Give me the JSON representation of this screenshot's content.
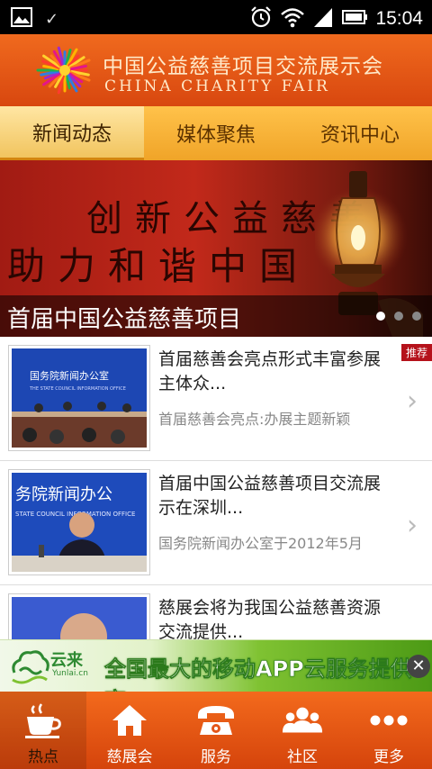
{
  "status_bar": {
    "time": "15:04",
    "icons": [
      "image-icon",
      "check-icon",
      "alarm-icon",
      "wifi-icon",
      "signal-icon",
      "battery-icon"
    ]
  },
  "header": {
    "title_cn": "中国公益慈善项目交流展示会",
    "title_en": "CHINA CHARITY FAIR",
    "logo_icon": "sunburst-logo-icon"
  },
  "tabs": [
    {
      "label": "新闻动态",
      "active": true
    },
    {
      "label": "媒体聚焦",
      "active": false
    },
    {
      "label": "资讯中心",
      "active": false
    }
  ],
  "banner": {
    "line1": "创新公益慈善",
    "line2": "助力和谐中国",
    "caption": "首届中国公益慈善项目",
    "slide_count": 3,
    "active_slide": 1
  },
  "news": [
    {
      "title": "首届慈善会亮点形式丰富参展主体众...",
      "subtitle": "首届慈善会亮点:办展主题新颖",
      "badge": "推荐",
      "thumb_text": "国务院新闻办公室",
      "thumb_text_en": "THE STATE COUNCIL INFORMATION OFFICE"
    },
    {
      "title": "首届中国公益慈善项目交流展示在深圳...",
      "subtitle": "国务院新闻办公室于2012年5月",
      "badge": "",
      "thumb_text": "务院新闻办公",
      "thumb_text_en": "STATE COUNCIL INFORMATION OFFICE"
    },
    {
      "title": "慈展会将为我国公益慈善资源交流提供...",
      "subtitle": "",
      "badge": "",
      "thumb_text": "",
      "thumb_text_en": ""
    }
  ],
  "ad": {
    "brand": "云来",
    "brand_sub": "Yunlai.cn",
    "text": "全国最大的移动APP云服务提供商",
    "close_symbol": "✕"
  },
  "bottom_nav": [
    {
      "label": "热点",
      "icon": "coffee-cup-icon",
      "active": true
    },
    {
      "label": "慈展会",
      "icon": "home-icon",
      "active": false
    },
    {
      "label": "服务",
      "icon": "telephone-icon",
      "active": false
    },
    {
      "label": "社区",
      "icon": "people-icon",
      "active": false
    },
    {
      "label": "更多",
      "icon": "more-dots-icon",
      "active": false
    }
  ],
  "colors": {
    "brand_orange": "#e45a17",
    "tab_gold": "#f0a428",
    "badge_red": "#b5121b",
    "ad_green": "#4c9a15"
  }
}
